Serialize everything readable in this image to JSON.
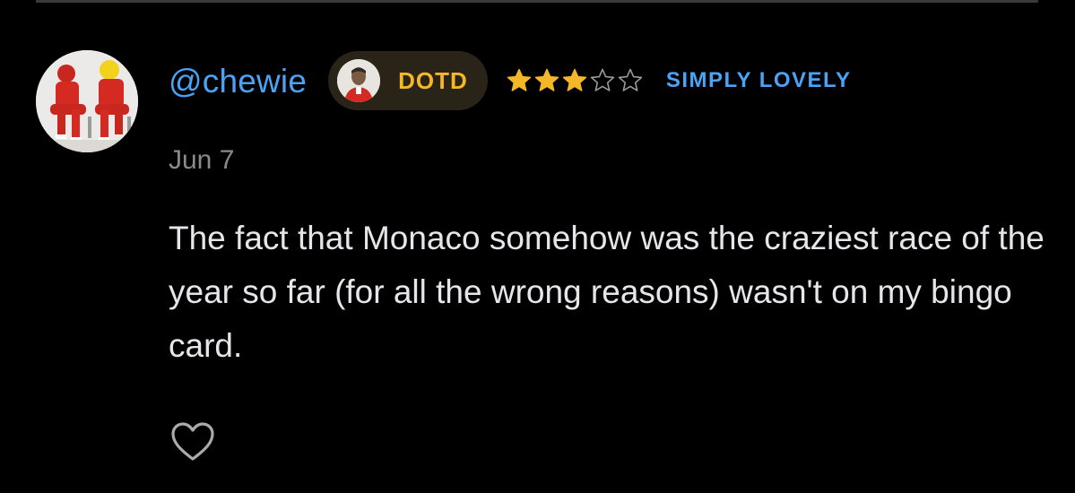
{
  "review": {
    "username": "@chewie",
    "badge_label": "DOTD",
    "rating": 3,
    "rating_max": 5,
    "rating_label": "SIMPLY LOVELY",
    "date": "Jun 7",
    "text": "The fact that Monaco somehow was the craziest race of the year so far (for all the wrong reasons) wasn't on my bingo card."
  },
  "icons": {
    "avatar": "user-avatar-image",
    "badge_avatar": "driver-avatar-image",
    "star": "star-icon",
    "like": "heart-icon"
  },
  "colors": {
    "background": "#000000",
    "username": "#4aa3f5",
    "badge_background": "#2a2418",
    "badge_text": "#f4b726",
    "star_filled": "#f4b726",
    "star_empty": "#9a9a9a",
    "rating_label": "#4aa3f5",
    "date": "#8a8a8e",
    "text": "#e6e6ea",
    "like_icon": "#a9a9ae"
  }
}
